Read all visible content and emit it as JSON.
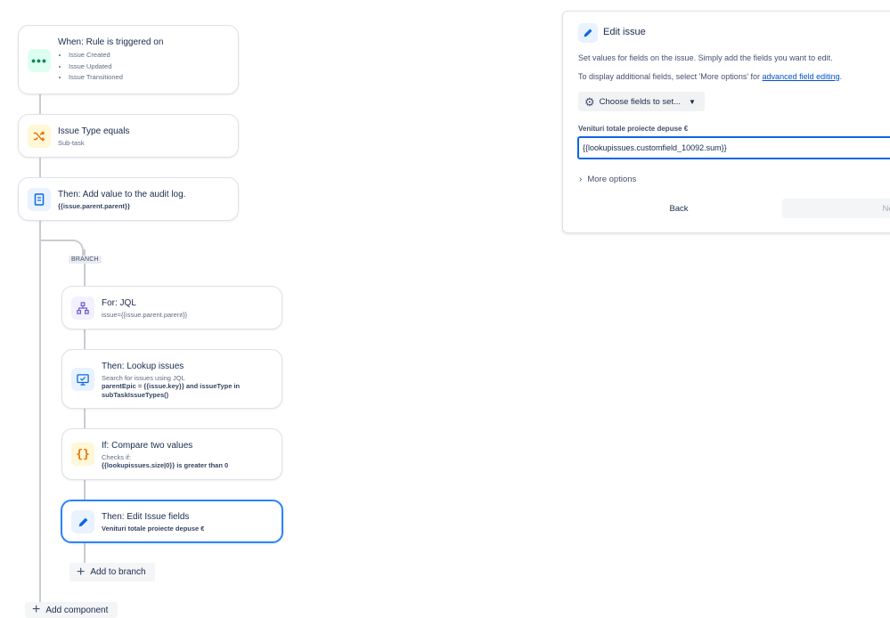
{
  "flow": {
    "trigger": {
      "title": "When: Rule is triggered on",
      "items": [
        "Issue Created",
        "Issue Updated",
        "Issue Transitioned"
      ]
    },
    "condition": {
      "title": "Issue Type equals",
      "sub": "Sub-task"
    },
    "audit": {
      "title": "Then: Add value to the audit log.",
      "sub": "{{issue.parent.parent}}"
    },
    "branch_tag": "BRANCH",
    "for_jql": {
      "title": "For: JQL",
      "sub": "issue={{issue.parent.parent}}"
    },
    "lookup": {
      "title": "Then: Lookup issues",
      "sub": "Search for issues using JQL",
      "jql_line1": "parentEpic = {{issue.key}} and issueType in",
      "jql_line2": "subTaskIssueTypes()"
    },
    "compare": {
      "title": "If: Compare two values",
      "sub": "Checks if:",
      "expr": "{{lookupissues.size|0}} is greater than 0"
    },
    "edit": {
      "title": "Then: Edit Issue fields",
      "sub": "Venituri totale proiecte depuse €"
    },
    "add_to_branch": "Add to branch",
    "add_component": "Add component"
  },
  "panel": {
    "title": "Edit issue",
    "desc1": "Set values for fields on the issue. Simply add the fields you want to edit.",
    "desc2_prefix": "To display additional fields, select 'More options' for ",
    "desc2_link": "advanced field editing",
    "desc2_suffix": ".",
    "choose_button": "Choose fields to set...",
    "field_label": "Venituri totale proiecte depuse €",
    "field_value": "{{lookupissues.customfield_10092.sum}}",
    "more_options": "More options",
    "back_button": "Back",
    "next_button": "Next"
  },
  "colors": {
    "trigger_icon_bg": "#dcfff1",
    "trigger_icon_fg": "#1f845a",
    "condition_icon_bg": "#fff7d6",
    "condition_icon_fg": "#e2740c",
    "action_icon_bg": "#e9f2ff",
    "action_icon_fg": "#0c66e4",
    "branch_icon_bg": "#f3f0ff",
    "branch_icon_fg": "#6e5dc6",
    "selected_border": "#2684ff"
  }
}
